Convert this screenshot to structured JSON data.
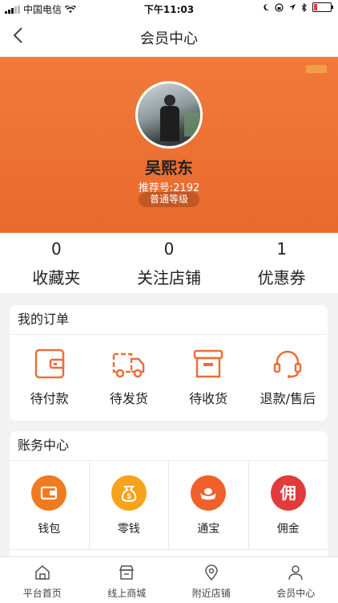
{
  "status": {
    "carrier": "中国电信",
    "time": "下午11:03"
  },
  "nav": {
    "title": "会员中心"
  },
  "profile": {
    "name": "吴熙东",
    "ref": "推荐号:2192",
    "level": "普通等级"
  },
  "stats": [
    {
      "value": "0",
      "label": "收藏夹"
    },
    {
      "value": "0",
      "label": "关注店铺"
    },
    {
      "value": "1",
      "label": "优惠券"
    }
  ],
  "orders": {
    "title": "我的订单",
    "items": [
      {
        "label": "待付款",
        "icon": "wallet-icon"
      },
      {
        "label": "待发货",
        "icon": "truck-icon"
      },
      {
        "label": "待收货",
        "icon": "box-icon"
      },
      {
        "label": "退款/售后",
        "icon": "headset-icon"
      }
    ]
  },
  "account": {
    "title": "账务中心",
    "items": [
      {
        "label": "钱包",
        "icon": "wallet-icon",
        "color": "#f07a1f"
      },
      {
        "label": "零钱",
        "icon": "money-bag-icon",
        "color": "#f5a31a"
      },
      {
        "label": "通宝",
        "icon": "ingot-icon",
        "color": "#f0602a"
      },
      {
        "label": "佣金",
        "icon": "commission-icon",
        "glyph": "佣",
        "color": "#e23b3b"
      }
    ]
  },
  "tabs": [
    {
      "label": "平台首页",
      "icon": "home-icon"
    },
    {
      "label": "线上商城",
      "icon": "shop-icon"
    },
    {
      "label": "附近店铺",
      "icon": "location-pin-icon"
    },
    {
      "label": "会员中心",
      "icon": "user-icon"
    }
  ]
}
